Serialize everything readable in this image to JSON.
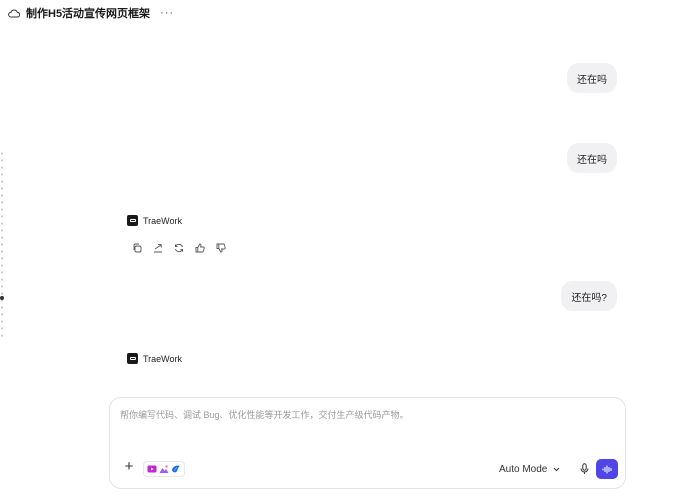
{
  "header": {
    "title": "制作H5活动宣传网页框架",
    "more_label": "···"
  },
  "conversation": {
    "user_messages": [
      {
        "text": "还在吗"
      },
      {
        "text": "还在吗"
      },
      {
        "text": "还在吗?"
      }
    ],
    "agent_name": "TraeWork",
    "action_icons": [
      "copy-icon",
      "share-icon",
      "regenerate-icon",
      "thumbs-up-icon",
      "thumbs-down-icon"
    ]
  },
  "composer": {
    "placeholder": "帮你编写代码、调试 Bug、优化性能等开发工作，交付生产级代码产物。",
    "value": "",
    "plus_label": "+",
    "mode_label": "Auto Mode",
    "mode_icon": "chevron-down-icon",
    "mic_icon": "microphone-icon",
    "send_icon": "voice-wave-icon",
    "send_color": "#4f46e5"
  }
}
